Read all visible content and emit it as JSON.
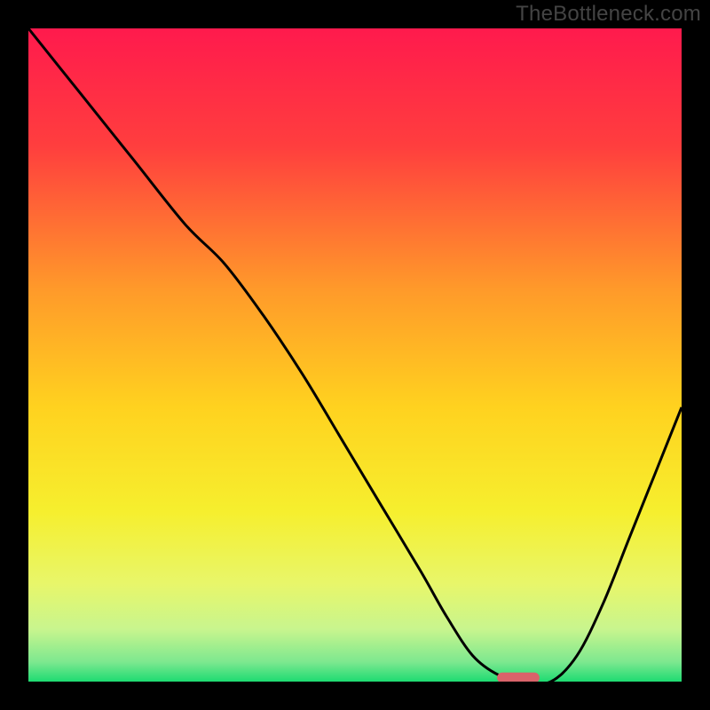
{
  "watermark": "TheBottleneck.com",
  "colors": {
    "black": "#000000",
    "curve": "#000000",
    "marker": "#d9636a"
  },
  "chart_data": {
    "type": "line",
    "title": "",
    "xlabel": "",
    "ylabel": "",
    "xlim": [
      0,
      100
    ],
    "ylim": [
      0,
      100
    ],
    "grid": false,
    "legend": false,
    "gradient_stops": [
      {
        "offset": 0,
        "color": "#ff1a4d"
      },
      {
        "offset": 18,
        "color": "#ff3e3e"
      },
      {
        "offset": 40,
        "color": "#ff9a2a"
      },
      {
        "offset": 58,
        "color": "#ffd21f"
      },
      {
        "offset": 74,
        "color": "#f6ef2e"
      },
      {
        "offset": 85,
        "color": "#e8f66a"
      },
      {
        "offset": 92,
        "color": "#c8f58e"
      },
      {
        "offset": 97,
        "color": "#7de88f"
      },
      {
        "offset": 100,
        "color": "#1edb72"
      }
    ],
    "series": [
      {
        "name": "bottleneck-curve",
        "x": [
          0,
          8,
          16,
          24,
          30,
          36,
          42,
          48,
          54,
          60,
          64,
          68,
          72,
          76,
          80,
          84,
          88,
          92,
          96,
          100
        ],
        "y": [
          100,
          90,
          80,
          70,
          64,
          56,
          47,
          37,
          27,
          17,
          10,
          4,
          1,
          0,
          0,
          4,
          12,
          22,
          32,
          42
        ]
      }
    ],
    "marker": {
      "name": "optimal-range",
      "shape": "pill",
      "x_center": 75,
      "y": 0.6,
      "width": 6.5,
      "height": 1.6,
      "color": "#d9636a"
    }
  }
}
